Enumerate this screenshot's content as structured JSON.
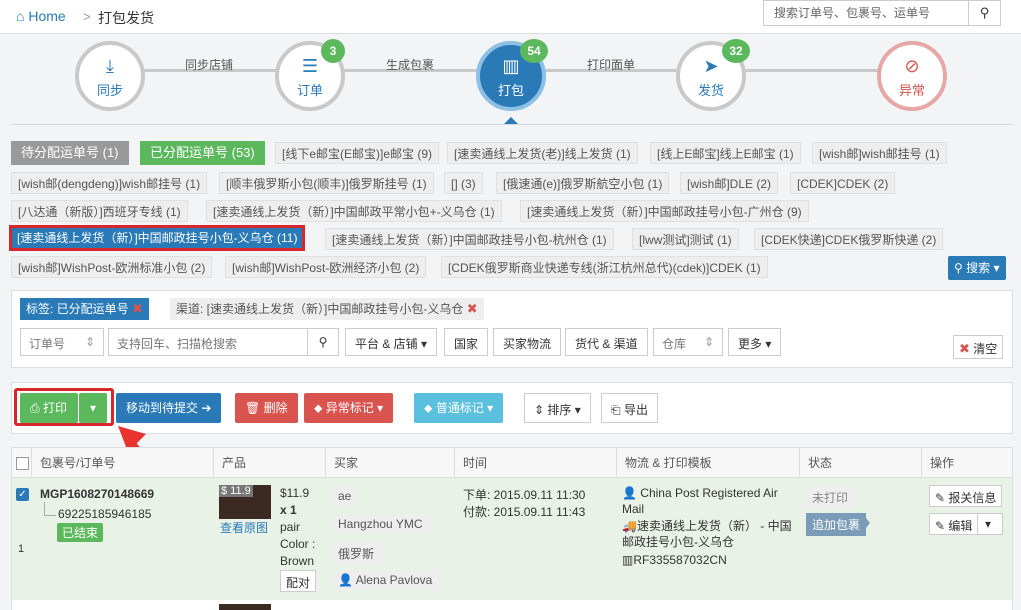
{
  "breadcrumb": {
    "home": "Home",
    "sep": ">",
    "current": "打包发货"
  },
  "top_search": {
    "placeholder": "搜索订单号、包裹号、运单号"
  },
  "steps": [
    {
      "label": "同步",
      "badge": ""
    },
    {
      "label": "订单",
      "badge": "3"
    },
    {
      "label": "打包",
      "badge": "54"
    },
    {
      "label": "发货",
      "badge": "32"
    },
    {
      "label": "异常",
      "badge": ""
    }
  ],
  "step_labels": [
    "同步店铺",
    "生成包裹",
    "打印面单"
  ],
  "tabs": {
    "pending": "待分配运单号 (1)",
    "assigned": "已分配运单号 (53)"
  },
  "tags_row1": [
    "[线下e邮宝(E邮宝)]e邮宝 (9)",
    "[速卖通线上发货(老)]线上发货 (1)",
    "[线上E邮宝]线上E邮宝 (1)",
    "[wish邮]wish邮挂号 (1)"
  ],
  "tags_row2": [
    "[wish邮(dengdeng)]wish邮挂号 (1)",
    "[顺丰俄罗斯小包(顺丰)]俄罗斯挂号 (1)",
    "[] (3)",
    "[俄速通(e)]俄罗斯航空小包 (1)",
    "[wish邮]DLE (2)",
    "[CDEK]CDEK (2)"
  ],
  "tags_row3": [
    "[八达通（新版）]西班牙专线 (1)",
    "[速卖通线上发货（新）]中国邮政平常小包+-义乌仓 (1)",
    "[速卖通线上发货（新）]中国邮政挂号小包-广州仓 (9)"
  ],
  "tags_row4": [
    "[速卖通线上发货（新）]中国邮政挂号小包-义乌仓 (11)",
    "[速卖通线上发货（新）]中国邮政挂号小包-杭州仓 (1)",
    "[lww测试]测试 (1)",
    "[CDEK快递]CDEK俄罗斯快递 (2)"
  ],
  "tags_row5": [
    "[wish邮]WishPost-欧洲标准小包 (2)",
    "[wish邮]WishPost-欧洲经济小包 (2)",
    "[CDEK俄罗斯商业快递专线(浙江杭州总代)(cdek)]CDEK (1)"
  ],
  "search_toggle": "搜索",
  "filter": {
    "tag_label": "标签: 已分配运单号",
    "channel_label": "渠道: [速卖通线上发货（新）]中国邮政挂号小包-义乌仓",
    "order_select": "订单号",
    "scan_placeholder": "支持回车、扫描枪搜索",
    "platform": "平台 & 店铺",
    "country": "国家",
    "buyer_logistics": "买家物流",
    "goods_channel": "货代 & 渠道",
    "warehouse": "仓库",
    "more": "更多",
    "clear": "清空"
  },
  "actions": {
    "print": "打印",
    "move": "移动到待提交",
    "delete": "删除",
    "exception": "异常标记",
    "normal": "普通标记",
    "sort": "排序",
    "export": "导出"
  },
  "table": {
    "headers": [
      "包裹号/订单号",
      "产品",
      "买家",
      "时间",
      "物流 & 打印模板",
      "状态",
      "操作"
    ],
    "row": {
      "package_no": "MGP1608270148669",
      "order_no": "69225185946185",
      "finished": "已结束",
      "index": "1",
      "price_badge": "$ 11.9",
      "view_image": "查看原图",
      "price": "$11.9",
      "qty": "x 1",
      "unit": "pair",
      "color_label": "Color :",
      "color_value": "Brown",
      "match": "配对",
      "buyer_tag": "ae",
      "buyer_city": "Hangzhou YMC",
      "buyer_country": "俄罗斯",
      "buyer_name": "Alena Pavlova",
      "order_time": "下单: 2015.09.11 11:30",
      "pay_time": "付款: 2015.09.11 11:43",
      "carrier": "China Post Registered Air Mail",
      "channel": "速卖通线上发货（新） - 中国邮政挂号小包-义乌仓",
      "tracking": "RF335587032CN",
      "status": "未打印",
      "add_package": "追加包裹",
      "report": "报关信息",
      "edit": "编辑"
    }
  }
}
